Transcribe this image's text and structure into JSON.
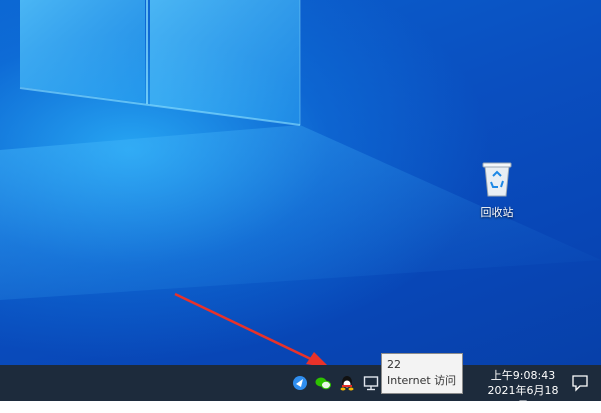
{
  "desktop": {
    "icons": [
      {
        "label": "回收站",
        "icon": "recycle-bin-icon"
      }
    ]
  },
  "tooltip": {
    "line1": "22",
    "line2": "Internet 访问"
  },
  "taskbar": {
    "tray_icons": [
      "feishu-icon",
      "wechat-icon",
      "qq-icon",
      "network-icon"
    ],
    "clock_time": "上午9:08:43",
    "clock_date": "2021年6月18日",
    "notification_icon": "action-center-icon"
  },
  "colors": {
    "taskbar": "#1d2b3c",
    "wallpaper_primary": "#0a4fc0",
    "wallpaper_highlight": "#28aaf5",
    "annotation_arrow": "#e8322a"
  }
}
